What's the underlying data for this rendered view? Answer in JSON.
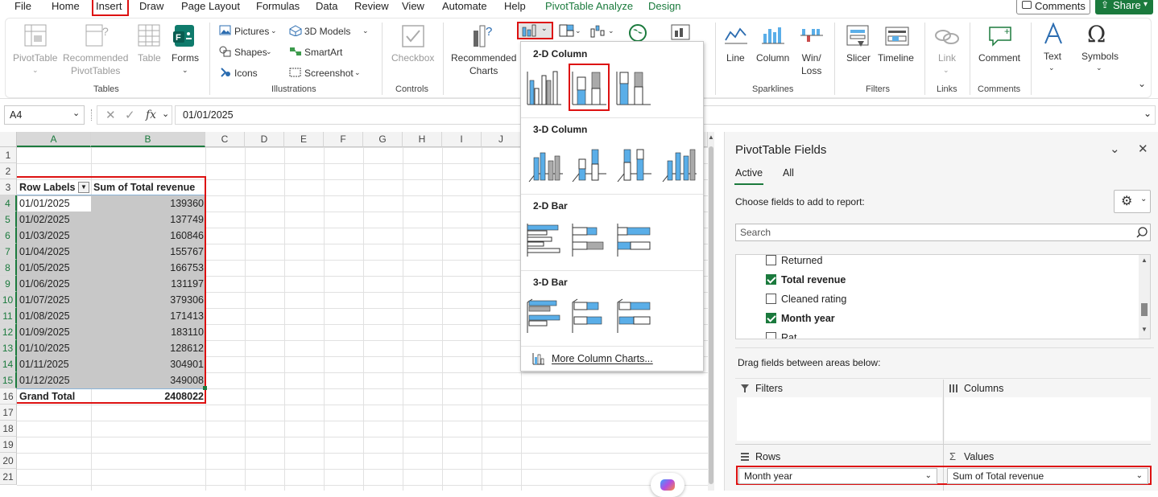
{
  "menu": {
    "tabs": [
      "File",
      "Home",
      "Insert",
      "Draw",
      "Page Layout",
      "Formulas",
      "Data",
      "Review",
      "View",
      "Automate",
      "Help",
      "PivotTable Analyze",
      "Design"
    ],
    "comments_label": "Comments",
    "share_label": "Share"
  },
  "ribbon": {
    "pivottable": "PivotTable",
    "recommended_pivot_1": "Recommended",
    "recommended_pivot_2": "PivotTables",
    "table": "Table",
    "forms": "Forms",
    "group_tables": "Tables",
    "pictures": "Pictures",
    "shapes": "Shapes",
    "icons": "Icons",
    "models3d": "3D Models",
    "smartart": "SmartArt",
    "screenshot": "Screenshot",
    "group_illustrations": "Illustrations",
    "checkbox": "Checkbox",
    "group_controls": "Controls",
    "rec_charts_1": "Recommended",
    "rec_charts_2": "Charts",
    "spark_line": "Line",
    "spark_column": "Column",
    "spark_winloss_1": "Win/",
    "spark_winloss_2": "Loss",
    "group_sparklines": "Sparklines",
    "slicer": "Slicer",
    "timeline": "Timeline",
    "group_filters": "Filters",
    "link": "Link",
    "group_links": "Links",
    "comment": "Comment",
    "group_comments": "Comments",
    "text": "Text",
    "symbols": "Symbols"
  },
  "formula_bar": {
    "name_box": "A4",
    "fx": "fx",
    "value": "01/01/2025"
  },
  "sheet": {
    "columns": [
      "A",
      "B",
      "C",
      "D",
      "E",
      "F",
      "G",
      "H",
      "I",
      "J"
    ],
    "rows": [
      "1",
      "2",
      "3",
      "4",
      "5",
      "6",
      "7",
      "8",
      "9",
      "10",
      "11",
      "12",
      "13",
      "14",
      "15",
      "16",
      "17",
      "18",
      "19",
      "20",
      "21"
    ],
    "header_row_labels": "Row Labels",
    "header_sum": "Sum of Total revenue",
    "data": [
      {
        "label": "01/01/2025",
        "value": "139360"
      },
      {
        "label": "01/02/2025",
        "value": "137749"
      },
      {
        "label": "01/03/2025",
        "value": "160846"
      },
      {
        "label": "01/04/2025",
        "value": "155767"
      },
      {
        "label": "01/05/2025",
        "value": "166753"
      },
      {
        "label": "01/06/2025",
        "value": "131197"
      },
      {
        "label": "01/07/2025",
        "value": "379306"
      },
      {
        "label": "01/08/2025",
        "value": "171413"
      },
      {
        "label": "01/09/2025",
        "value": "183110"
      },
      {
        "label": "01/10/2025",
        "value": "128612"
      },
      {
        "label": "01/11/2025",
        "value": "304901"
      },
      {
        "label": "01/12/2025",
        "value": "349008"
      }
    ],
    "grand_total_label": "Grand Total",
    "grand_total_value": "2408022"
  },
  "gallery": {
    "section_2d_column": "2-D Column",
    "section_3d_column": "3-D Column",
    "section_2d_bar": "2-D Bar",
    "section_3d_bar": "3-D Bar",
    "more": "More Column Charts..."
  },
  "pane": {
    "title": "PivotTable Fields",
    "tab_active": "Active",
    "tab_all": "All",
    "choose": "Choose fields to add to report:",
    "search_placeholder": "Search",
    "fields": [
      {
        "name": "Returned",
        "checked": false
      },
      {
        "name": "Total revenue",
        "checked": true
      },
      {
        "name": "Cleaned rating",
        "checked": false
      },
      {
        "name": "Month year",
        "checked": true
      },
      {
        "name": "Rat",
        "checked": false
      }
    ],
    "drag_text": "Drag fields between areas below:",
    "area_filters": "Filters",
    "area_columns": "Columns",
    "area_rows": "Rows",
    "area_values": "Values",
    "rows_value": "Month year",
    "values_value": "Sum of Total revenue"
  },
  "colors": {
    "excel_green": "#1b7a3d",
    "highlight_red": "#d11111",
    "selection_gray": "#c8c8c8",
    "chart_blue": "#5aaee8"
  }
}
